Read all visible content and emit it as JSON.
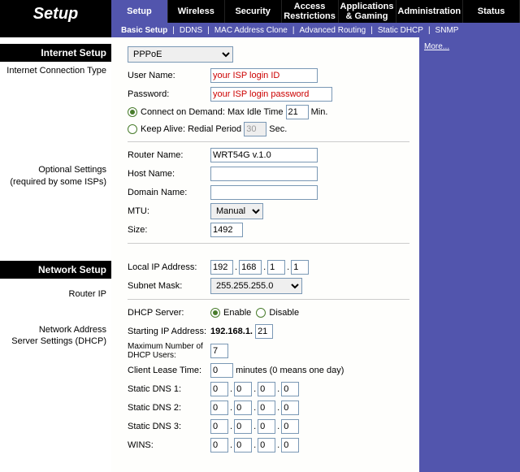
{
  "app": {
    "title": "Setup"
  },
  "nav": {
    "tabs": [
      "Setup",
      "Wireless",
      "Security",
      "Access\nRestrictions",
      "Applications\n& Gaming",
      "Administration",
      "Status"
    ],
    "sub": {
      "basic": "Basic Setup",
      "ddns": "DDNS",
      "mac": "MAC Address Clone",
      "adv": "Advanced Routing",
      "sdhcp": "Static DHCP",
      "snmp": "SNMP"
    }
  },
  "sections": {
    "internet_setup": "Internet Setup",
    "conn_type": "Internet Connection Type",
    "optional": "Optional Settings",
    "optional2": "(required by some ISPs)",
    "network_setup": "Network Setup",
    "router_ip": "Router IP",
    "dhcp": "Network Address",
    "dhcp2": "Server Settings (DHCP)"
  },
  "wan": {
    "type": "PPPoE",
    "user_lbl": "User Name:",
    "user_val": "your ISP login ID",
    "pass_lbl": "Password:",
    "pass_val": "your ISP login password",
    "cod_lbl": "Connect on Demand: Max Idle Time",
    "cod_val": "21",
    "cod_unit": "Min.",
    "ka_lbl": "Keep Alive: Redial Period",
    "ka_val": "30",
    "ka_unit": "Sec."
  },
  "opt": {
    "router_lbl": "Router Name:",
    "router_val": "WRT54G v.1.0",
    "host_lbl": "Host Name:",
    "host_val": "",
    "domain_lbl": "Domain Name:",
    "domain_val": "",
    "mtu_lbl": "MTU:",
    "mtu_mode": "Manual",
    "size_lbl": "Size:",
    "size_val": "1492"
  },
  "lan": {
    "ip_lbl": "Local IP Address:",
    "ip": [
      "192",
      "168",
      "1",
      "1"
    ],
    "mask_lbl": "Subnet Mask:",
    "mask": "255.255.255.0"
  },
  "dhcp": {
    "server_lbl": "DHCP Server:",
    "enable": "Enable",
    "disable": "Disable",
    "start_lbl": "Starting IP Address:",
    "start_prefix": "192.168.1.",
    "start_val": "21",
    "max_lbl": "Maximum Number of DHCP Users:",
    "max_val": "7",
    "lease_lbl": "Client Lease Time:",
    "lease_val": "0",
    "lease_unit": "minutes (0 means one day)",
    "dns1_lbl": "Static DNS 1:",
    "dns2_lbl": "Static DNS 2:",
    "dns3_lbl": "Static DNS 3:",
    "wins_lbl": "WINS:",
    "oct": [
      "0",
      "0",
      "0",
      "0"
    ]
  },
  "side": {
    "more": "More..."
  }
}
